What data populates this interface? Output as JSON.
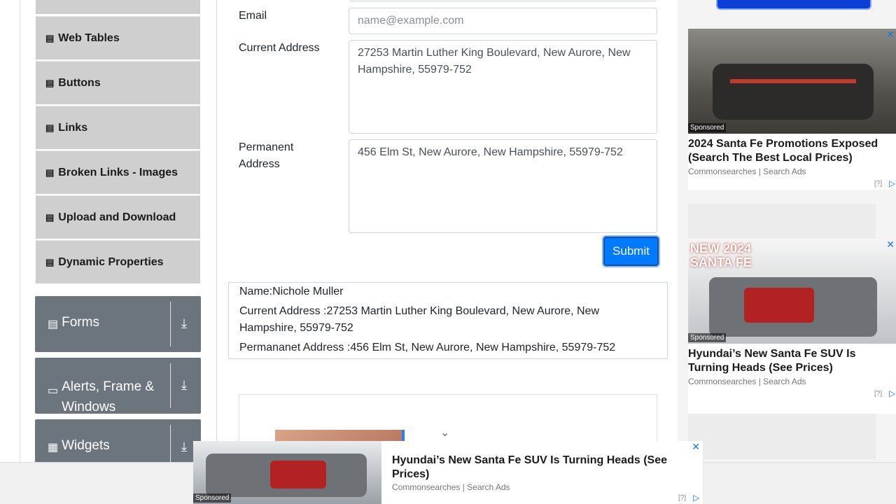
{
  "sidebar": {
    "elements_items": [
      {
        "label": "Web Tables"
      },
      {
        "label": "Buttons"
      },
      {
        "label": "Links"
      },
      {
        "label": "Broken Links - Images"
      },
      {
        "label": "Upload and Download"
      },
      {
        "label": "Dynamic Properties"
      }
    ],
    "groups": [
      {
        "label": "Forms"
      },
      {
        "label": "Alerts, Frame & Windows"
      },
      {
        "label": "Widgets"
      }
    ]
  },
  "form": {
    "email_label": "Email",
    "email_placeholder": "name@example.com",
    "current_address_label": "Current Address",
    "current_address_value": "27253 Martin Luther King Boulevard, New Aurore, New Hampshire, 55979-752",
    "permanent_address_label": "Permanent Address",
    "permanent_address_value": "456 Elm St, New Aurore, New Hampshire, 55979-752",
    "submit_label": "Submit"
  },
  "output": {
    "name": "Name:Nichole Muller",
    "current_address": "Current Address :27253 Martin Luther King Boulevard, New Aurore, New Hampshire, 55979-752",
    "permanent_address": "Permananet Address :456 Elm St, New Aurore, New Hampshire, 55979-752"
  },
  "ads": {
    "ad1": {
      "sponsored": "Sponsored",
      "title": "2024 Santa Fe Promotions Exposed (Search The Best Local Prices)",
      "source": "Commonsearches | Search Ads",
      "info": "[?]"
    },
    "ad2": {
      "sponsored": "Sponsored",
      "banner": "NEW 2024 SANTA FE",
      "title": "Hyundai’s New Santa Fe SUV Is Turning Heads (See Prices)",
      "source": "Commonsearches | Search Ads",
      "info": "[?]"
    },
    "bottom": {
      "sponsored": "Sponsored",
      "title": "Hyundai’s New Santa Fe SUV Is Turning Heads (See Prices)",
      "source": "Commonsearches | Search Ads",
      "info": "[?]"
    }
  },
  "colors": {
    "accent": "#007bff",
    "group_bg": "#6c757d",
    "menu_bg": "#cfcfcf"
  }
}
